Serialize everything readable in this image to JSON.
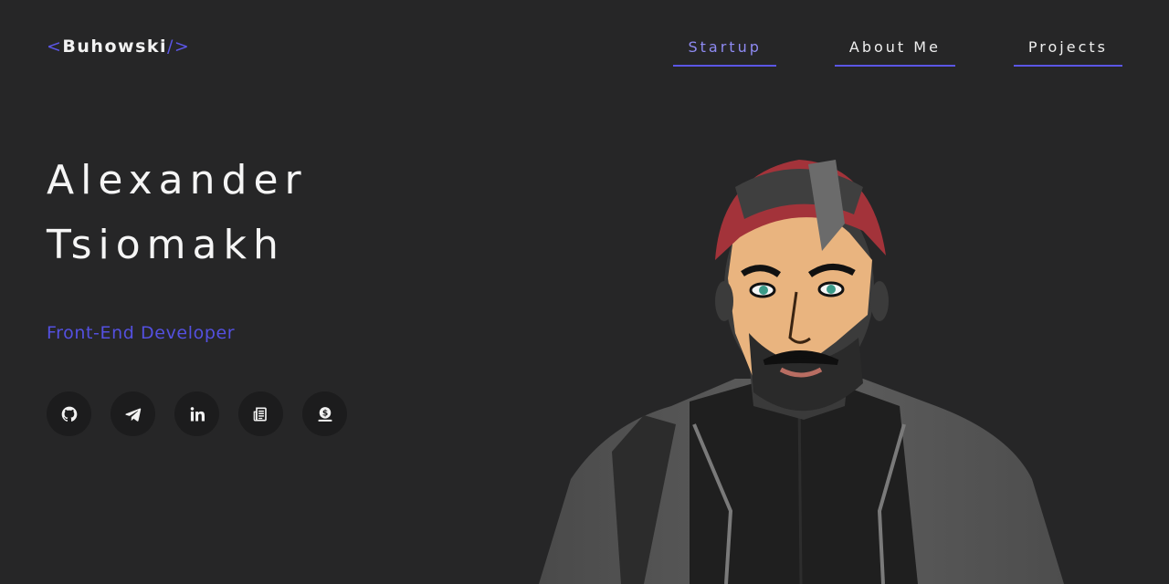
{
  "header": {
    "logo": {
      "open_bracket": "<",
      "name": "Buhowski",
      "close_bracket": "/>"
    },
    "nav": [
      {
        "label": "Startup",
        "active": true
      },
      {
        "label": "About Me",
        "active": false
      },
      {
        "label": "Projects",
        "active": false
      }
    ]
  },
  "hero": {
    "first_name": "Alexander",
    "last_name": "Tsiomakh",
    "role": "Front-End Developer"
  },
  "socials": [
    {
      "icon": "github-icon"
    },
    {
      "icon": "telegram-icon"
    },
    {
      "icon": "linkedin-icon"
    },
    {
      "icon": "resume-icon"
    },
    {
      "icon": "donate-icon"
    }
  ],
  "colors": {
    "background": "#262627",
    "accent": "#5b56e6",
    "accent_text": "#5450e0",
    "social_bg": "#1c1c1d"
  }
}
